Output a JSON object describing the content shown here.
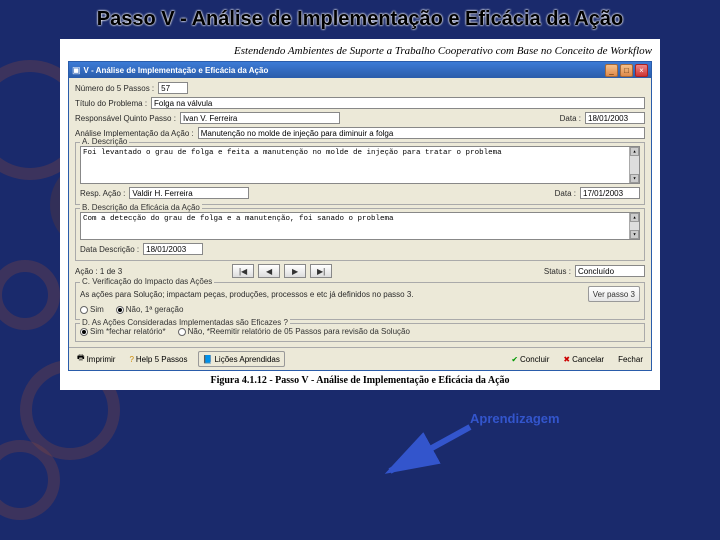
{
  "slide_title": "Passo V - Análise de Implementação e Eficácia da Ação",
  "doc_header": "Estendendo Ambientes de Suporte a Trabalho Cooperativo com Base no Conceito de Workflow",
  "window_title": "V - Análise de Implementação e Eficácia da Ação",
  "fields": {
    "numero_lbl": "Número do 5 Passos :",
    "numero_val": "57",
    "titulo_lbl": "Título do Problema :",
    "titulo_val": "Folga na válvula",
    "resp_lbl": "Responsável Quinto Passo :",
    "resp_val": "Ivan V. Ferreira",
    "data_lbl": "Data :",
    "data_val": "18/01/2003",
    "analise_lbl": "Análise Implementação da Ação :",
    "analise_val": "Manutenção no molde de injeção para diminuir a folga"
  },
  "frameA": {
    "legend": "A. Descrição",
    "text": "Foi levantado o grau de folga e feita a manutenção no molde de injeção para tratar o problema",
    "resp_lbl": "Resp. Ação :",
    "resp_val": "Valdir H. Ferreira",
    "date_lbl": "Data :",
    "date_val": "17/01/2003"
  },
  "frameB": {
    "legend": "B. Descrição da Eficácia da Ação",
    "text": "Com a detecção do grau de folga e a manutenção, foi sanado o problema",
    "date_lbl": "Data Descrição :",
    "date_val": "18/01/2003"
  },
  "nav": {
    "acao_lbl": "Ação : 1 de 3",
    "status_lbl": "Status :",
    "status_val": "Concluído"
  },
  "frameC": {
    "legend": "C. Verificação do Impacto das Ações",
    "question": "As ações para Solução; impactam peças, produções, processos e etc já definidos no passo 3.",
    "btn": "Ver passo 3",
    "opt_yes": "Sim",
    "opt_no": "Não, 1ª geração"
  },
  "frameD": {
    "legend": "D. As Ações Consideradas Implementadas são Eficazes ?",
    "opt_yes": "Sim *fechar relatório*",
    "opt_no": "Não, *Reemitir relatório de 05 Passos para revisão da Solução"
  },
  "annotation": "Aprendizagem",
  "buttons": {
    "imprimir": "Imprimir",
    "help": "Help 5 Passos",
    "licoes": "Lições Aprendidas",
    "concluir": "Concluir",
    "cancelar": "Cancelar",
    "fechar": "Fechar"
  },
  "caption": "Figura 4.1.12 - Passo V - Análise de Implementação e Eficácia da Ação",
  "colors": {
    "accent": "#2a5caa",
    "annotation": "#3355cc"
  }
}
